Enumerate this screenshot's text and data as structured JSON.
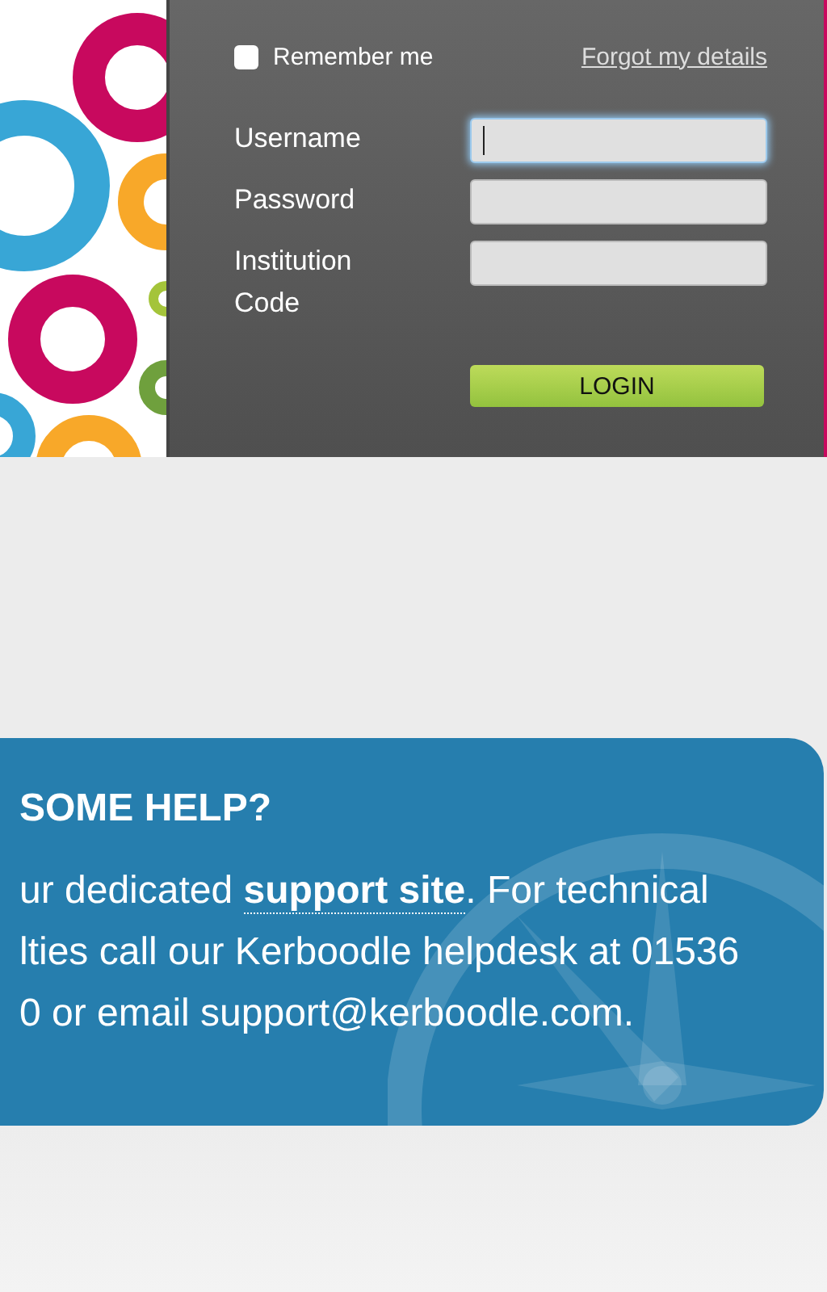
{
  "remember_me": {
    "label": "Remember me",
    "checked": false
  },
  "forgot_link": "Forgot my details",
  "fields": [
    {
      "label": "Username",
      "focused": true
    },
    {
      "label": "Password",
      "focused": false
    },
    {
      "label": "Institution Code",
      "focused": false
    }
  ],
  "login_button": "LOGIN",
  "help": {
    "heading": "SOME HELP?",
    "lines": [
      [
        {
          "kind": "text",
          "text": "ur dedicated "
        },
        {
          "kind": "link",
          "text": "support site"
        },
        {
          "kind": "text",
          "text": ". For technical"
        }
      ],
      [
        {
          "kind": "text",
          "text": "lties call our Kerboodle helpdesk at 01536"
        }
      ],
      [
        {
          "kind": "text",
          "text": "0 or email support@kerboodle.com."
        }
      ]
    ]
  }
}
